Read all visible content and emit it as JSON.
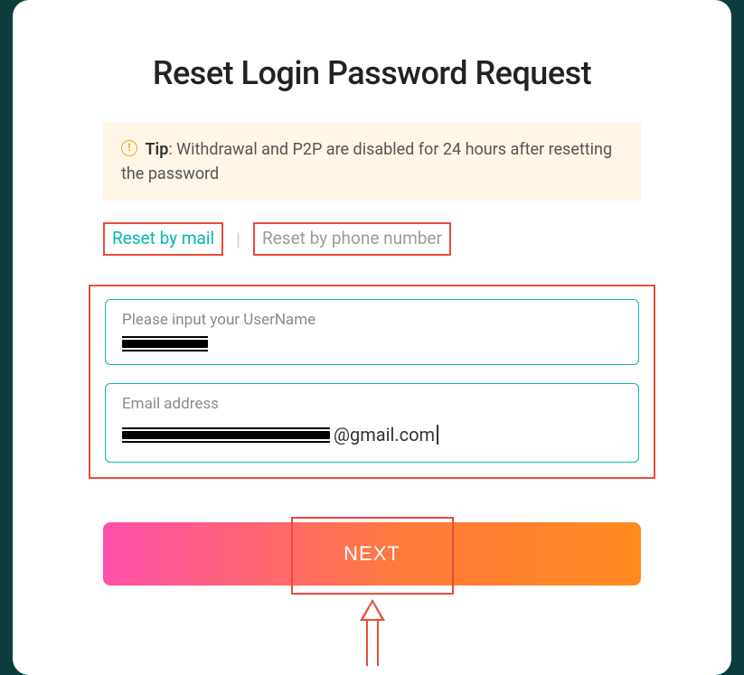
{
  "title": "Reset Login Password Request",
  "tip": {
    "label": "Tip",
    "text": ": Withdrawal and P2P are disabled for 24 hours after resetting the password"
  },
  "tabs": {
    "mail": "Reset by mail",
    "phone": "Reset by phone number"
  },
  "fields": {
    "username": {
      "label": "Please input your UserName",
      "value_redacted": true
    },
    "email": {
      "label": "Email address",
      "value_visible_suffix": "@gmail.com"
    }
  },
  "next_button": "NEXT"
}
